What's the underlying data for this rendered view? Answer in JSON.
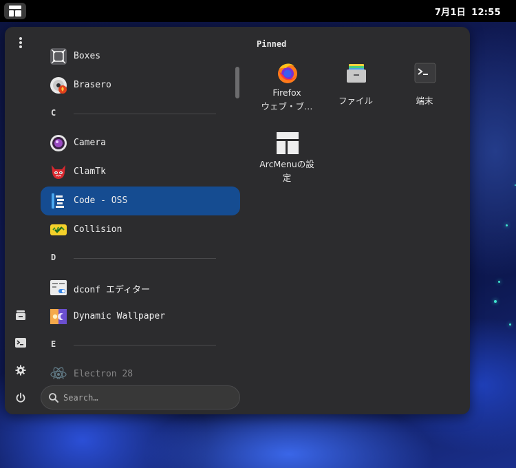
{
  "topbar": {
    "date": "7月1日",
    "time": "12:55"
  },
  "rail": {
    "items": [
      {
        "name": "files",
        "icon": "file-cabinet-icon"
      },
      {
        "name": "terminal",
        "icon": "terminal-icon"
      },
      {
        "name": "settings",
        "icon": "gear-icon"
      },
      {
        "name": "power",
        "icon": "power-icon"
      }
    ]
  },
  "app_list": {
    "rows": [
      {
        "kind": "app",
        "label": "Boxes",
        "icon": "boxes-icon"
      },
      {
        "kind": "app",
        "label": "Brasero",
        "icon": "brasero-disc-icon"
      },
      {
        "kind": "section",
        "label": "C"
      },
      {
        "kind": "app",
        "label": "Camera",
        "icon": "camera-icon"
      },
      {
        "kind": "app",
        "label": "ClamTk",
        "icon": "clamtk-icon"
      },
      {
        "kind": "app",
        "label": "Code - OSS",
        "icon": "code-oss-icon",
        "selected": true
      },
      {
        "kind": "app",
        "label": "Collision",
        "icon": "collision-icon"
      },
      {
        "kind": "section",
        "label": "D"
      },
      {
        "kind": "app",
        "label": "dconf エディター",
        "icon": "dconf-editor-icon"
      },
      {
        "kind": "app",
        "label": "Dynamic Wallpaper",
        "icon": "dynamic-wallpaper-icon"
      },
      {
        "kind": "section",
        "label": "E"
      },
      {
        "kind": "app",
        "label": "Electron 28",
        "icon": "electron-icon"
      }
    ]
  },
  "search": {
    "placeholder": "Search…"
  },
  "pinned": {
    "title": "Pinned",
    "items": [
      {
        "line1": "Firefox",
        "line2": "ウェブ・ブ…",
        "icon": "firefox-icon"
      },
      {
        "line1": "ファイル",
        "line2": "",
        "icon": "files-icon"
      },
      {
        "line1": "端末",
        "line2": "",
        "icon": "terminal-icon"
      },
      {
        "line1": "ArcMenuの設",
        "line2": "定",
        "icon": "arcmenu-settings-icon"
      }
    ]
  },
  "colors": {
    "panel": "#2c2c2e",
    "selected": "#154c91",
    "topbar": "#000000"
  }
}
